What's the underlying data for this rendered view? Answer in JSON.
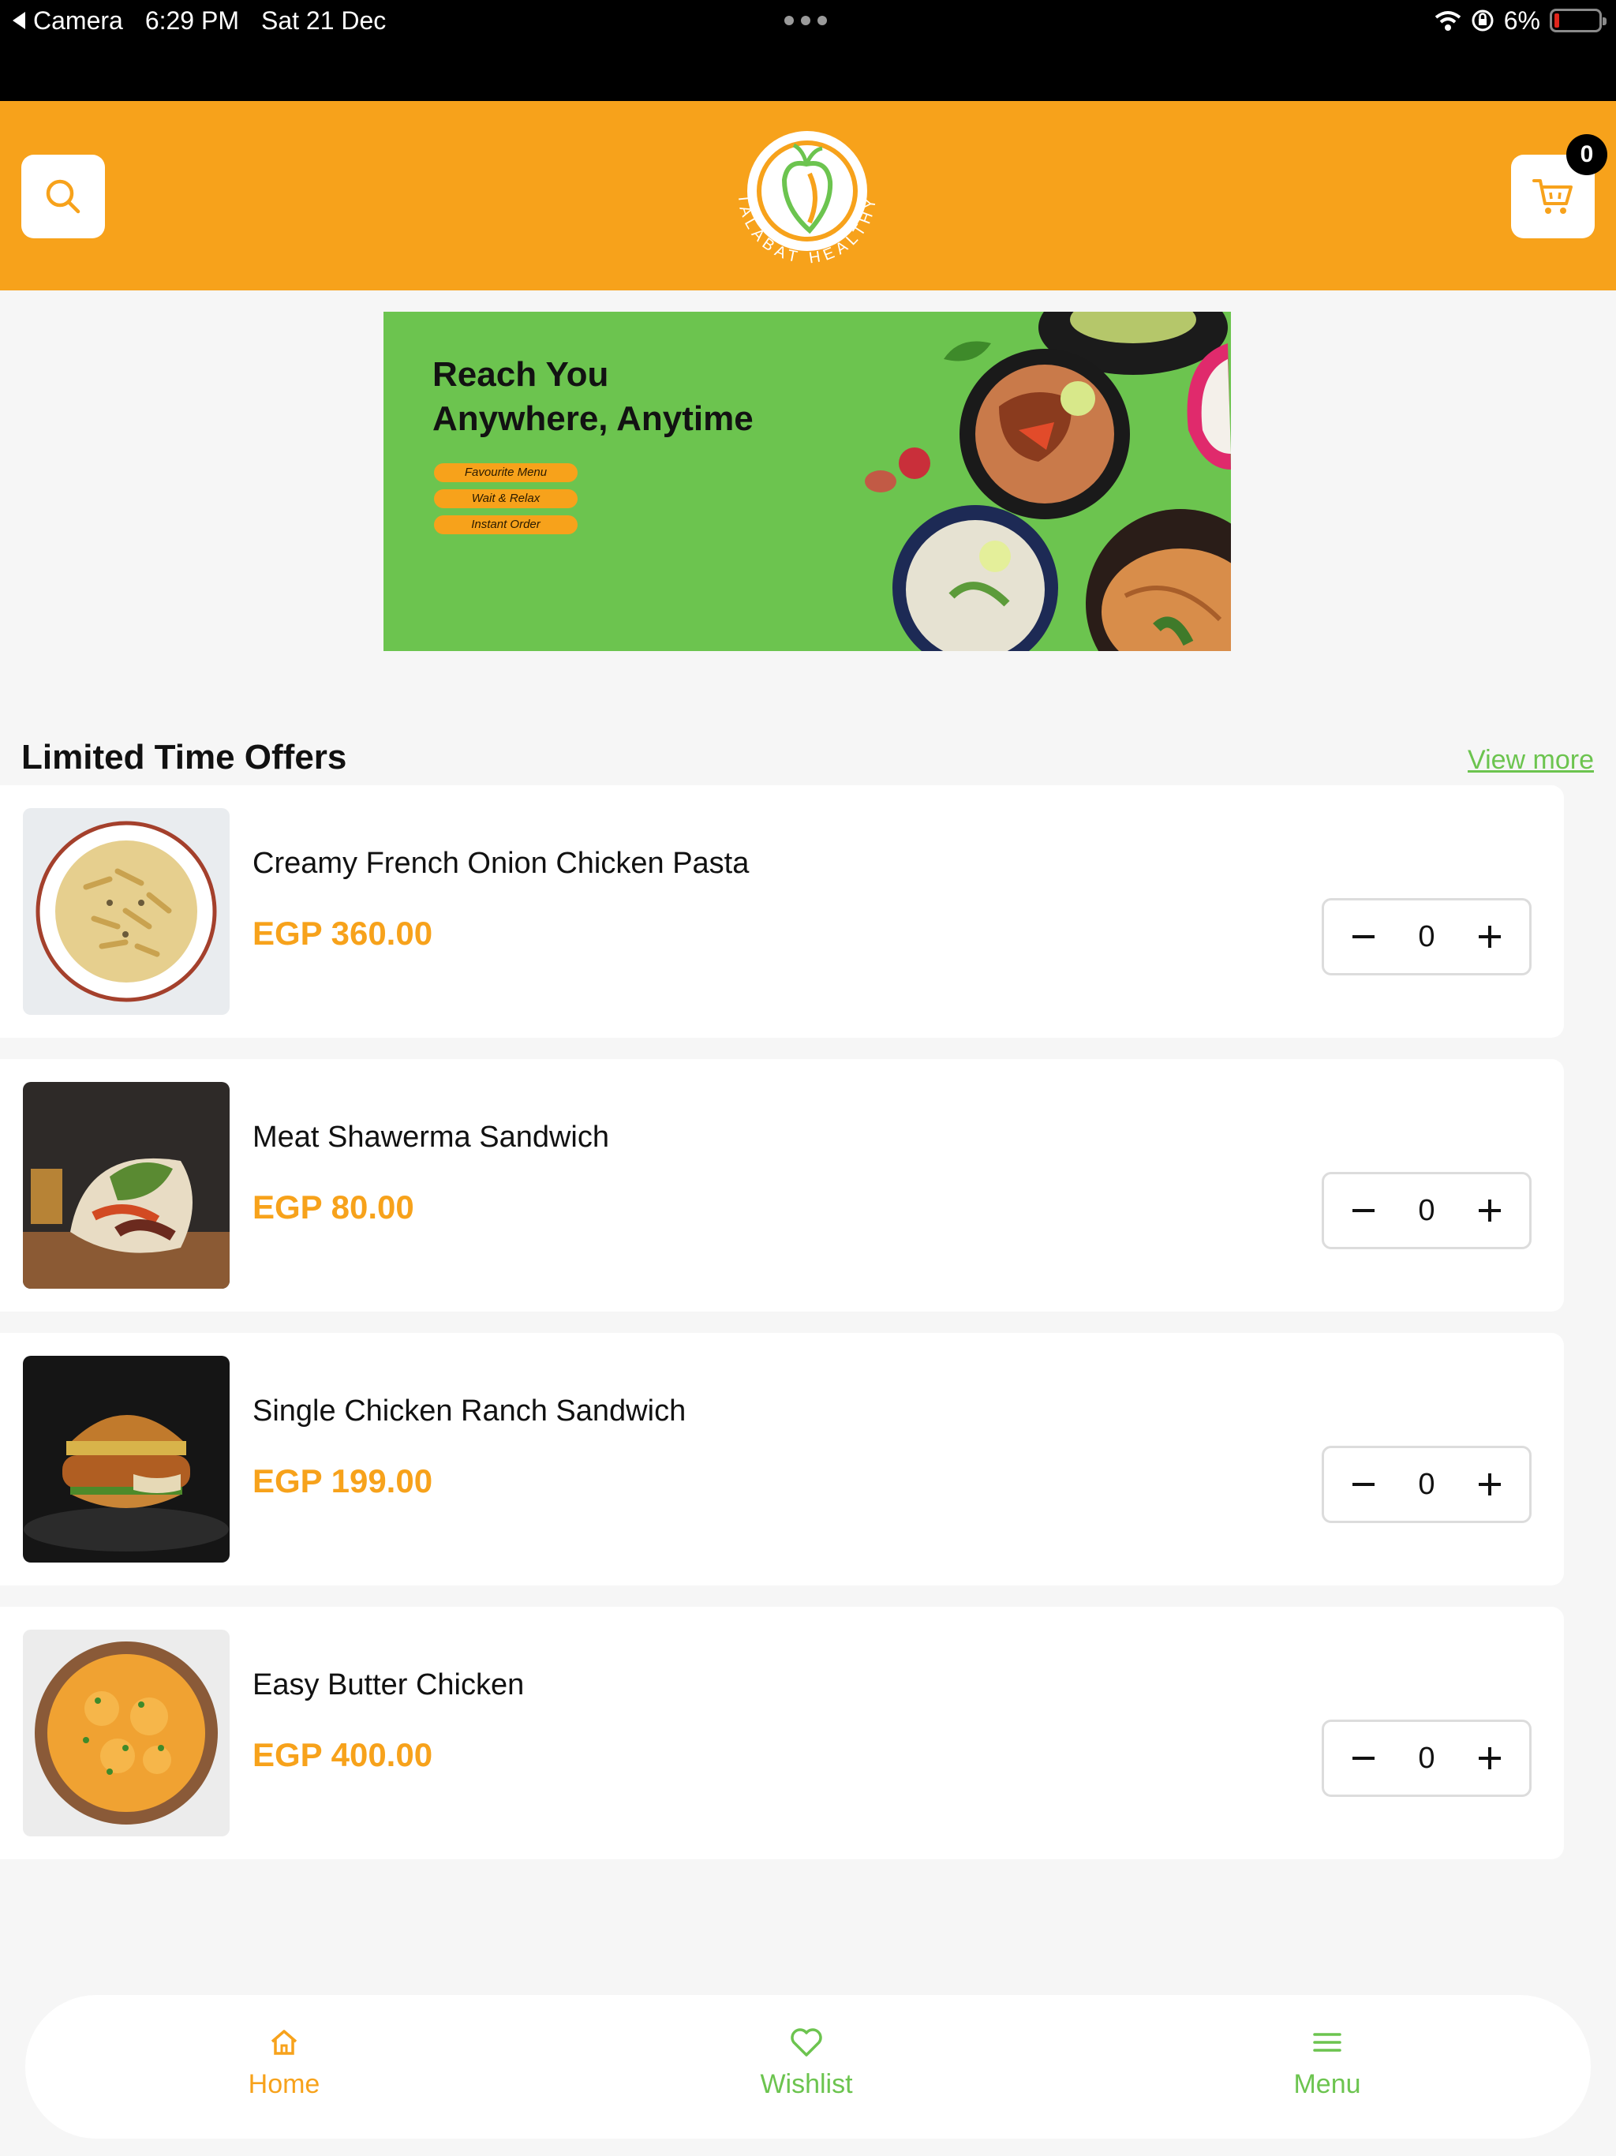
{
  "status_bar": {
    "back_app": "Camera",
    "time": "6:29 PM",
    "date": "Sat 21 Dec",
    "battery": "6%"
  },
  "header": {
    "logo_text": "TALABAT HEALTHY",
    "cart_count": "0",
    "colors": {
      "brand_orange": "#f7a21b",
      "brand_green": "#6cc44f"
    }
  },
  "banner": {
    "title_line1": "Reach You",
    "title_line2": "Anywhere, Anytime",
    "pills": [
      "Favourite Menu",
      "Wait & Relax",
      "Instant Order"
    ]
  },
  "section": {
    "title": "Limited Time Offers",
    "view_more": "View more"
  },
  "items": [
    {
      "name": "Creamy French Onion Chicken Pasta",
      "price": "EGP 360.00",
      "qty": "0"
    },
    {
      "name": "Meat Shawerma Sandwich",
      "price": "EGP 80.00",
      "qty": "0"
    },
    {
      "name": "Single Chicken Ranch Sandwich",
      "price": "EGP 199.00",
      "qty": "0"
    },
    {
      "name": "Easy Butter Chicken",
      "price": "EGP 400.00",
      "qty": "0"
    }
  ],
  "nav": {
    "home": "Home",
    "wishlist": "Wishlist",
    "menu": "Menu"
  }
}
